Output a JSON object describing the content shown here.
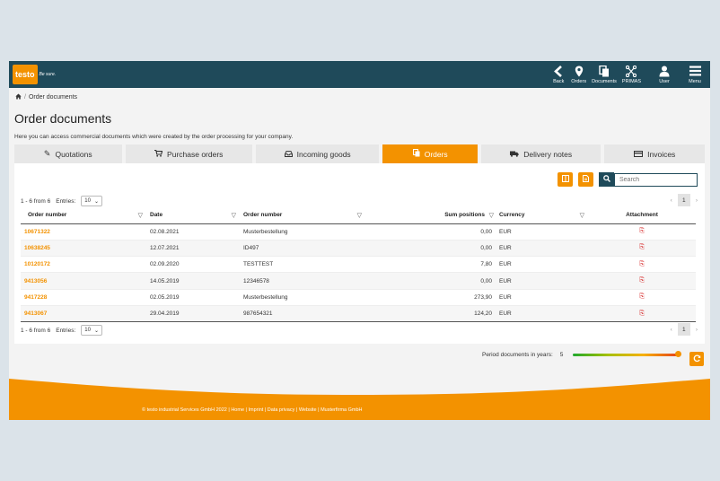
{
  "header": {
    "logo_text": "testo",
    "slogan": "Be sure.",
    "nav": [
      {
        "label": "Back",
        "icon": "back-icon"
      },
      {
        "label": "Orders",
        "icon": "location-pin-icon"
      },
      {
        "label": "Documents",
        "icon": "documents-icon"
      },
      {
        "label": "PRIMAS",
        "icon": "network-icon"
      },
      {
        "label": "User",
        "icon": "user-icon"
      },
      {
        "label": "Menu",
        "icon": "hamburger-menu-icon"
      }
    ]
  },
  "breadcrumb": {
    "home_icon": "home-icon",
    "separator": "/",
    "current": "Order documents"
  },
  "page": {
    "title": "Order documents",
    "intro": "Here you can access commercial documents which were created by the order processing for your company."
  },
  "tabs": [
    {
      "label": "Quotations",
      "icon": "edit-icon",
      "active": false
    },
    {
      "label": "Purchase orders",
      "icon": "cart-icon",
      "active": false
    },
    {
      "label": "Incoming goods",
      "icon": "inbox-icon",
      "active": false
    },
    {
      "label": "Orders",
      "icon": "copy-icon",
      "active": true
    },
    {
      "label": "Delivery notes",
      "icon": "truck-icon",
      "active": false
    },
    {
      "label": "Invoices",
      "icon": "credit-card-icon",
      "active": false
    }
  ],
  "toolbar": {
    "search_placeholder": "Search",
    "columns_icon": "columns-icon",
    "export_icon": "file-icon",
    "search_icon": "search-icon"
  },
  "table_info": {
    "range": "1 - 6 from 6",
    "entries_label": "Entries:",
    "entries_value": "10",
    "page": "1",
    "prev": "‹",
    "next": "›"
  },
  "table": {
    "headers": [
      "Order number",
      "Date",
      "Order number",
      "Sum positions",
      "Currency",
      "Attachment"
    ],
    "rows": [
      {
        "order": "10671322",
        "date": "02.08.2021",
        "ref": "Musterbestellung",
        "sum": "0,00",
        "currency": "EUR"
      },
      {
        "order": "10638245",
        "date": "12.07.2021",
        "ref": "ID497",
        "sum": "0,00",
        "currency": "EUR"
      },
      {
        "order": "10120172",
        "date": "02.09.2020",
        "ref": "TESTTEST",
        "sum": "7,80",
        "currency": "EUR"
      },
      {
        "order": "9413056",
        "date": "14.05.2019",
        "ref": "12346578",
        "sum": "0,00",
        "currency": "EUR"
      },
      {
        "order": "9417228",
        "date": "02.05.2019",
        "ref": "Musterbestellung",
        "sum": "273,90",
        "currency": "EUR"
      },
      {
        "order": "9413067",
        "date": "29.04.2019",
        "ref": "987654321",
        "sum": "124,20",
        "currency": "EUR"
      }
    ]
  },
  "period": {
    "label": "Period documents in years:",
    "value": "5",
    "slider_fraction": 1.0
  },
  "footer": {
    "text": "© testo industrial Services GmbH 2022 | Home | Imprint | Data privacy | Website | Musterfirma GmbH"
  },
  "colors": {
    "accent": "#f39200",
    "header": "#1f4a5a",
    "background": "#dbe3e9"
  }
}
